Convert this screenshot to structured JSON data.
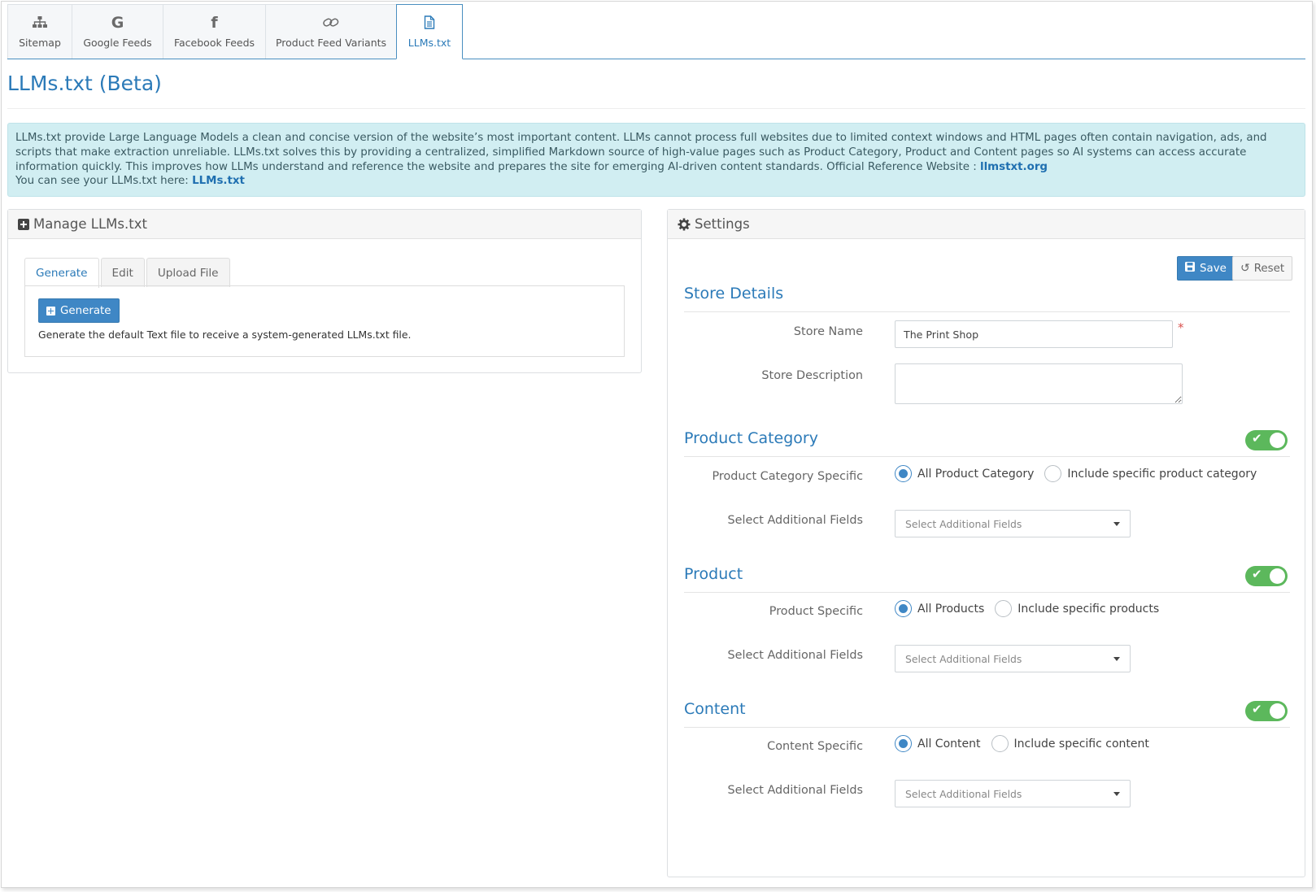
{
  "top_tabs": [
    {
      "label": "Sitemap",
      "icon": "sitemap-icon"
    },
    {
      "label": "Google Feeds",
      "icon": "google-icon"
    },
    {
      "label": "Facebook Feeds",
      "icon": "facebook-icon"
    },
    {
      "label": "Product Feed Variants",
      "icon": "link-icon"
    },
    {
      "label": "LLMs.txt",
      "icon": "file-text-icon",
      "active": true
    }
  ],
  "page_title": "LLMs.txt (Beta)",
  "info": {
    "text": "LLMs.txt provide Large Language Models a clean and concise version of the website’s most important content. LLMs cannot process full websites due to limited context windows and HTML pages often contain navigation, ads, and scripts that make extraction unreliable. LLMs.txt solves this by providing a centralized, simplified Markdown source of high-value pages such as Product Category, Product and Content pages so AI systems can access accurate information quickly. This improves how LLMs understand and reference the website and prepares the site for emerging AI-driven content standards. Official Reference Website : ",
    "reference_link": "llmstxt.org",
    "see_text": "You can see your LLMs.txt here: ",
    "see_link": "LLMs.txt"
  },
  "manage": {
    "title": "Manage LLMs.txt",
    "tabs": [
      "Generate",
      "Edit",
      "Upload File"
    ],
    "generate_button": "Generate",
    "help": "Generate the default Text file to receive a system-generated LLMs.txt file."
  },
  "settings": {
    "title": "Settings",
    "save_label": "Save",
    "reset_label": "Reset",
    "store_details": {
      "heading": "Store Details",
      "store_name_label": "Store Name",
      "store_name_value": "The Print Shop",
      "required_mark": "*",
      "store_description_label": "Store Description",
      "store_description_value": ""
    },
    "product_category": {
      "heading": "Product Category",
      "enabled": true,
      "specific_label": "Product Category Specific",
      "option_all": "All Product Category",
      "option_specific": "Include specific product category",
      "fields_label": "Select Additional Fields",
      "fields_placeholder": "Select Additional Fields"
    },
    "product": {
      "heading": "Product",
      "enabled": true,
      "specific_label": "Product Specific",
      "option_all": "All Products",
      "option_specific": "Include specific products",
      "fields_label": "Select Additional Fields",
      "fields_placeholder": "Select Additional Fields"
    },
    "content": {
      "heading": "Content",
      "enabled": true,
      "specific_label": "Content Specific",
      "option_all": "All Content",
      "option_specific": "Include specific content",
      "fields_label": "Select Additional Fields",
      "fields_placeholder": "Select Additional Fields"
    }
  },
  "colors": {
    "accent": "#2b7ab8",
    "primary_button": "#3f87c5",
    "toggle_on": "#5cb85c",
    "info_background": "#d1eef2"
  }
}
